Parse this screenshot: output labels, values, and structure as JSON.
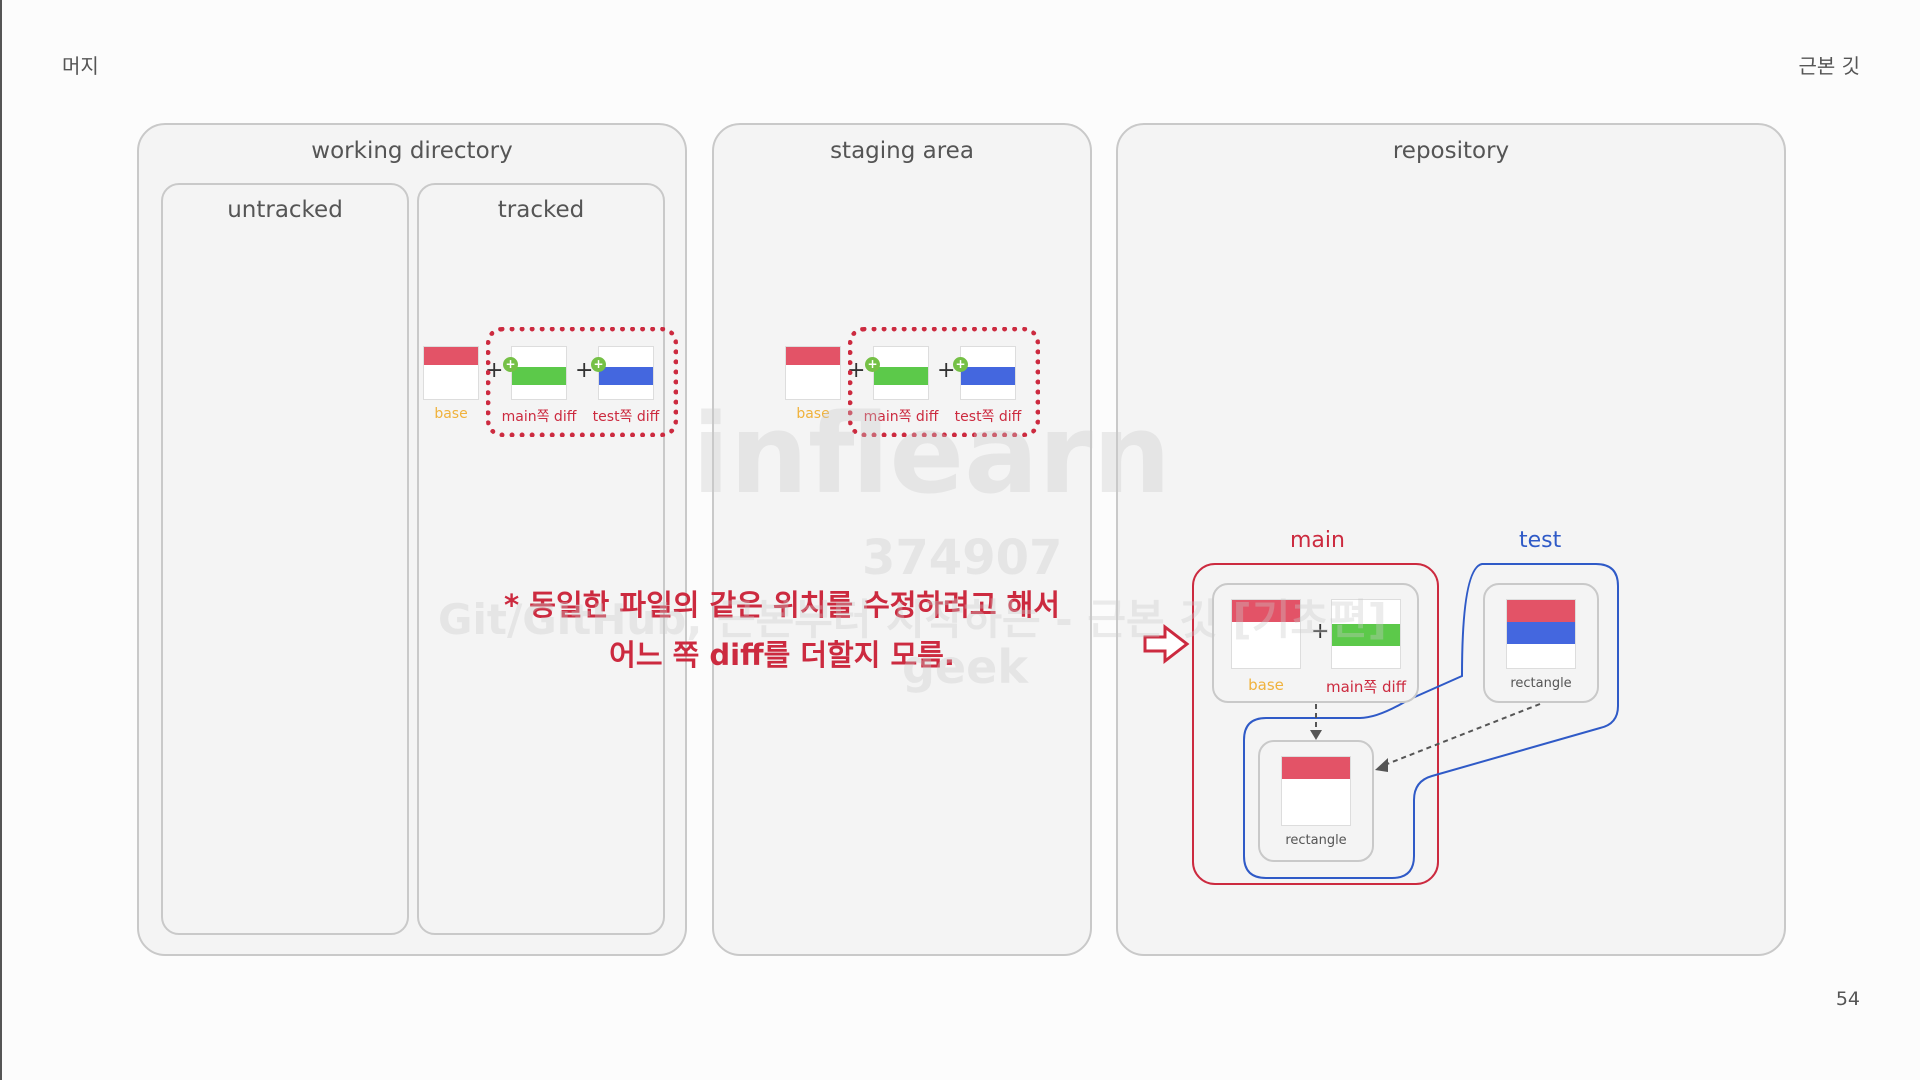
{
  "header": {
    "left": "머지",
    "right": "근본 깃"
  },
  "panels": {
    "working_directory": "working directory",
    "untracked": "untracked",
    "tracked": "tracked",
    "staging_area": "staging area",
    "repository": "repository"
  },
  "files": {
    "base": "base",
    "main_diff": "main쪽 diff",
    "test_diff": "test쪽 diff",
    "rectangle": "rectangle"
  },
  "branches": {
    "main": "main",
    "test": "test"
  },
  "message": {
    "line1": "* 동일한 파일의 같은 위치를 수정하려고 해서",
    "line2": "어느 쪽 diff를 더할지 모름."
  },
  "watermark": {
    "brand": "inflearn",
    "id": "374907",
    "course": "Git/GitHub, 근본부터 시작하는 - 근본 깃 [기초편]",
    "user": "geek"
  },
  "page_number": "54",
  "colors": {
    "red": "#e35367",
    "green": "#5cc94a",
    "blue": "#4467df",
    "accent": "#cc2a3f",
    "base_label": "#f0b23c",
    "test_branch": "#2f5ac7"
  }
}
